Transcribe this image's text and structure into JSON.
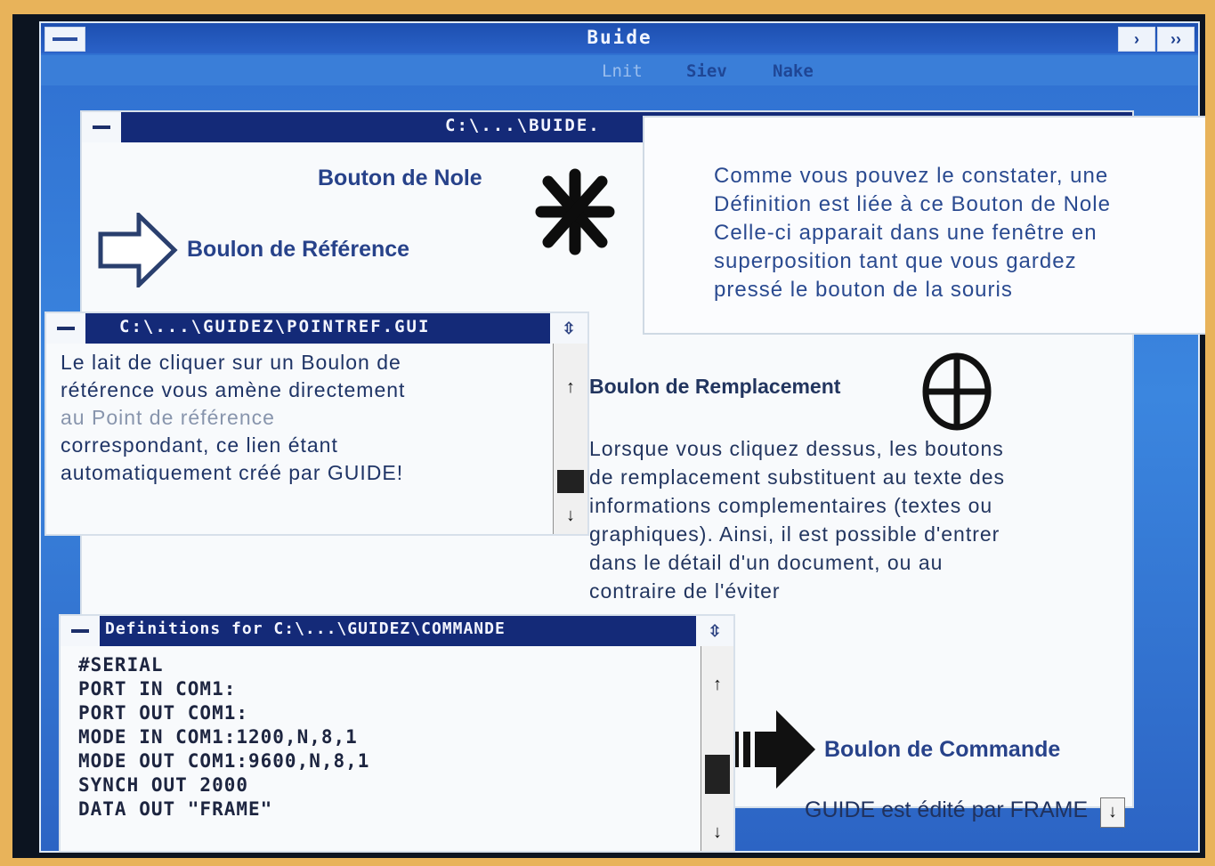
{
  "app": {
    "title": "Buide",
    "menu": [
      "",
      "",
      "",
      "",
      "",
      "Lnit",
      "Siev",
      "Nake"
    ],
    "min_glyph": "›",
    "max_glyph": "››"
  },
  "main_doc": {
    "title": "C:\\...\\BUIDE.",
    "note_label": "Bouton de Nole",
    "reference_label": "Boulon de Référence",
    "replacement_label": "Boulon de Remplacement",
    "replacement_text": [
      "Lorsque vous cliquez dessus, les boutons",
      "de remplacement substituent au texte des",
      "informations complementaires (textes ou",
      "graphiques). Ainsi, il est possible d'entrer",
      "dans le détail d'un document, ou au",
      "contraire de l'éviter"
    ],
    "command_label": "Boulon de Commande",
    "footer": "GUIDE est édité par FRAME"
  },
  "note_popup": {
    "lines": [
      "Comme vous pouvez le constater, une",
      "Définition est liée à ce Bouton de Nole",
      "Celle-ci apparait dans une fenêtre en",
      "superposition tant que vous gardez",
      "pressé le bouton de la souris"
    ]
  },
  "ref_window": {
    "title": "C:\\...\\GUIDEZ\\POINTREF.GUI",
    "lines": [
      "Le lait de cliquer sur un Boulon de",
      "rétérence vous amène directement",
      "au Point de référence",
      "correspondant, ce lien étant",
      "automatiquement créé par GUIDE!"
    ]
  },
  "defs_window": {
    "title": "Definitions for C:\\...\\GUIDEZ\\COMMANDE",
    "lines": [
      "#SERIAL",
      "PORT IN COM1:",
      "PORT OUT COM1:",
      "MODE IN COM1:1200,N,8,1",
      "MODE OUT COM1:9600,N,8,1",
      "SYNCH OUT 2000",
      "DATA OUT \"FRAME\""
    ]
  },
  "icons": {
    "scroll_up": "↑",
    "scroll_down": "↓",
    "size_box": "⇳"
  }
}
